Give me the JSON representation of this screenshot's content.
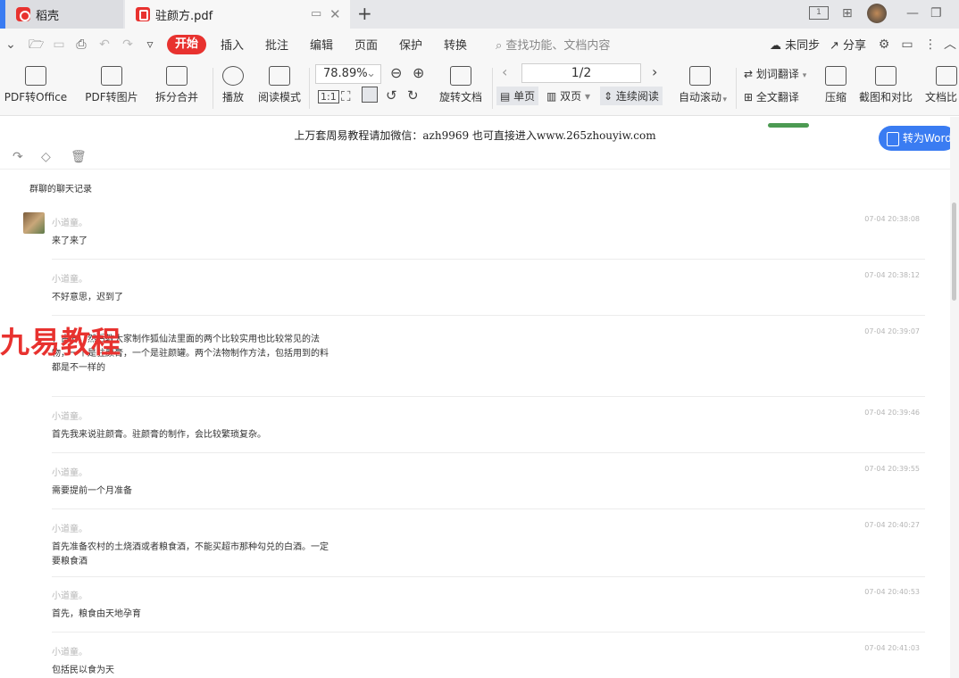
{
  "tabs": [
    {
      "label": "稻壳",
      "icon": "daoke-logo-icon"
    },
    {
      "label": "驻颜方.pdf",
      "icon": "pdf-file-icon"
    }
  ],
  "menu": {
    "start": "开始",
    "items": [
      "插入",
      "批注",
      "编辑",
      "页面",
      "保护",
      "转换"
    ],
    "search_placeholder": "查找功能、文档内容",
    "sync": "未同步",
    "share": "分享"
  },
  "toolbar": {
    "pdf_to_office": "PDF转Office",
    "pdf_to_image": "PDF转图片",
    "split_merge": "拆分合并",
    "play": "播放",
    "read_mode": "阅读模式",
    "zoom": "78.89%",
    "rotate_doc": "旋转文档",
    "page": "1/2",
    "single": "单页",
    "double": "双页",
    "continuous": "连续阅读",
    "auto_scroll": "自动滚动",
    "word_translate": "划词翻译",
    "full_translate": "全文翻译",
    "compress": "压缩",
    "screenshot_compare": "截图和对比",
    "doc_compare": "文档比"
  },
  "document": {
    "header": "上万套周易教程请加微信：azh9969   也可直接进入www.265zhouyiw.com",
    "to_word": "转为Word",
    "group_title": "群聊的聊天记录",
    "watermark": "九易教程",
    "messages": [
      {
        "name": "小道童。",
        "time": "07-04 20:38:08",
        "text": "来了来了"
      },
      {
        "name": "小道童。",
        "time": "07-04 20:38:12",
        "text": "不好意思，迟到了"
      },
      {
        "name": "",
        "time": "07-04 20:39:07",
        "text": "、古方，然后教大家制作狐仙法里面的两个比较实用也比较常见的法物，一个是驻颜膏，一个是驻颜罐。两个法物制作方法，包括用到的料都是不一样的"
      },
      {
        "name": "小道童。",
        "time": "07-04 20:39:46",
        "text": "首先我来说驻颜膏。驻颜膏的制作，会比较繁琐复杂。"
      },
      {
        "name": "小道童。",
        "time": "07-04 20:39:55",
        "text": "需要提前一个月准备"
      },
      {
        "name": "小道童。",
        "time": "07-04 20:40:27",
        "text": "首先准备农村的土烧酒或者粮食酒，不能买超市那种勾兑的白酒。一定要粮食酒"
      },
      {
        "name": "小道童。",
        "time": "07-04 20:40:53",
        "text": "首先，粮食由天地孕育"
      },
      {
        "name": "小道童。",
        "time": "07-04 20:41:03",
        "text": "包括民以食为天"
      }
    ]
  }
}
